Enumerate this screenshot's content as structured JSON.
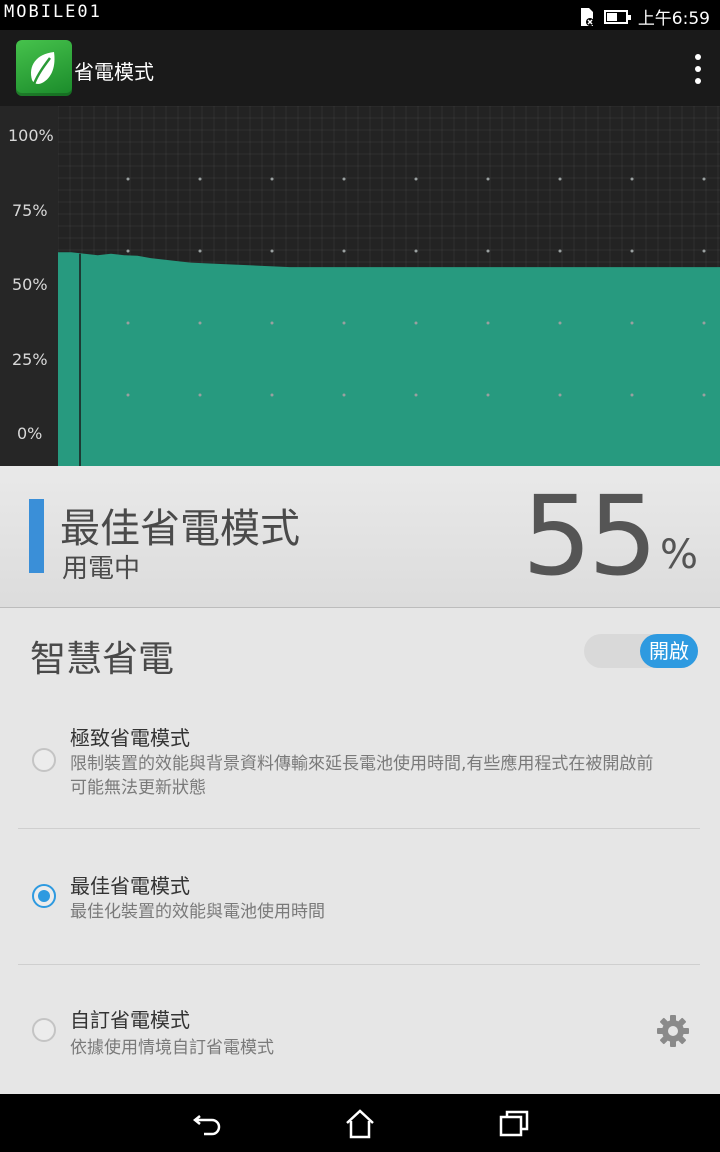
{
  "status_bar": {
    "watermark": "MOBILE01",
    "time": "上午6:59",
    "battery_level_fraction": 0.55
  },
  "app_bar": {
    "title": "省電模式",
    "logo_icon": "leaf-icon",
    "menu_icon": "overflow-menu-icon"
  },
  "chart_data": {
    "type": "area",
    "y_ticks": [
      "100%",
      "75%",
      "50%",
      "25%",
      "0%"
    ],
    "ylim": [
      0,
      100
    ],
    "x": [
      0,
      2,
      4,
      6,
      8,
      10,
      12,
      14,
      16,
      18,
      20,
      25,
      30,
      35,
      40,
      45,
      50,
      55,
      60,
      65,
      70,
      75,
      80,
      85,
      90,
      95,
      100
    ],
    "values": [
      61,
      61,
      60.5,
      60,
      60.5,
      60,
      59.8,
      59,
      58.5,
      58,
      57.5,
      57,
      56.5,
      56,
      56,
      56,
      56,
      56,
      56,
      56,
      56,
      56,
      56,
      56,
      56,
      56,
      56
    ],
    "grid": true,
    "colors": {
      "fill": "#279a7f",
      "background": "#232323",
      "grid_dot": "#9aa0a0"
    }
  },
  "current_mode": {
    "name": "最佳省電模式",
    "state": "用電中",
    "percent_value": "55",
    "percent_sign": "%",
    "accent_color": "#3a8fd8"
  },
  "smart_saving": {
    "title": "智慧省電",
    "toggle_label": "開啟",
    "toggle_on": true,
    "toggle_color": "#2e9ae0"
  },
  "options": [
    {
      "title": "極致省電模式",
      "description": "限制裝置的效能與背景資料傳輸來延長電池使用時間,有些應用程式在被開啟前可能無法更新狀態",
      "selected": false
    },
    {
      "title": "最佳省電模式",
      "description": "最佳化裝置的效能與電池使用時間",
      "selected": true
    },
    {
      "title": "自訂省電模式",
      "description": "依據使用情境自訂省電模式",
      "selected": false,
      "settings_icon": "gear-icon"
    }
  ],
  "nav_bar": {
    "back_icon": "back-icon",
    "home_icon": "home-icon",
    "recents_icon": "recent-apps-icon"
  }
}
